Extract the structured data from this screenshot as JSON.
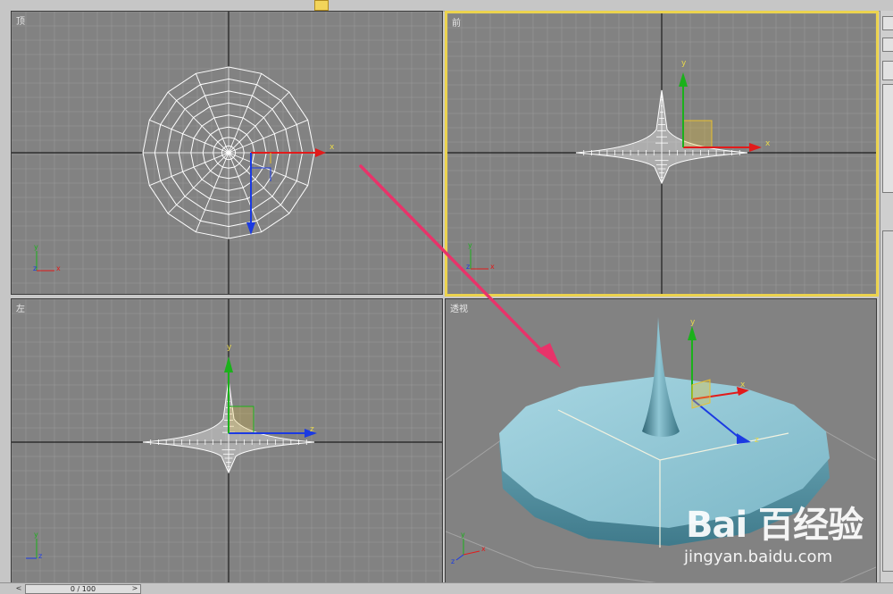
{
  "viewports": {
    "top": {
      "label": "顶"
    },
    "front": {
      "label": "前"
    },
    "left": {
      "label": "左"
    },
    "perspective": {
      "label": "透视"
    }
  },
  "axis_labels": {
    "x": "x",
    "y": "y",
    "z": "z"
  },
  "timeline": {
    "frame": "0 / 100",
    "prev": "<",
    "next": ">"
  },
  "watermark": {
    "logo": "Bai  百经验",
    "url": "jingyan.baidu.com"
  },
  "colors": {
    "viewport_bg": "#828282",
    "grid": "#9a9a9a",
    "active_border": "#ecd34e",
    "mesh": "#ffffff",
    "shaded_object": "#8fc6d4",
    "annotation_arrow": "#e8336a",
    "axis_x": "#e21b1b",
    "axis_y": "#1bb11b",
    "axis_z": "#1b3ae2"
  },
  "icons": [
    "pink-annotation-arrow",
    "transform-gizmo",
    "viewport-axis-tripod"
  ]
}
